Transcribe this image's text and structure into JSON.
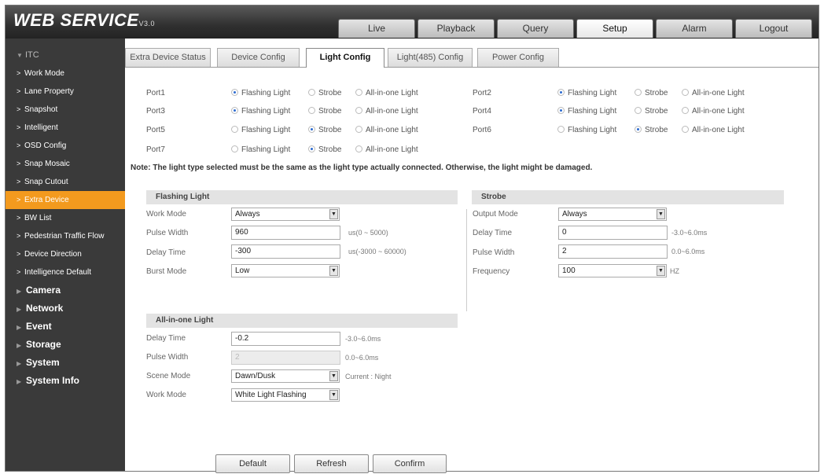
{
  "header": {
    "logo": "WEB SERVICE",
    "version": "V3.0",
    "tabs": [
      "Live",
      "Playback",
      "Query",
      "Setup",
      "Alarm",
      "Logout"
    ],
    "active_tab": "Setup"
  },
  "sidebar": {
    "section": "ITC",
    "items": [
      "Work Mode",
      "Lane Property",
      "Snapshot",
      "Intelligent",
      "OSD Config",
      "Snap Mosaic",
      "Snap Cutout",
      "Extra Device",
      "BW List",
      "Pedestrian Traffic Flow",
      "Device Direction",
      "Intelligence Default"
    ],
    "active_item": "Extra Device",
    "top_items": [
      "Camera",
      "Network",
      "Event",
      "Storage",
      "System",
      "System Info"
    ]
  },
  "subtabs": [
    "Extra Device Status",
    "Device Config",
    "Light Config",
    "Light(485) Config",
    "Power Config"
  ],
  "active_subtab": "Light Config",
  "radio_options": [
    "Flashing Light",
    "Strobe",
    "All-in-one Light"
  ],
  "ports": [
    {
      "label": "Port1",
      "selected": "Flashing Light"
    },
    {
      "label": "Port2",
      "selected": "Flashing Light"
    },
    {
      "label": "Port3",
      "selected": "Flashing Light"
    },
    {
      "label": "Port4",
      "selected": "Flashing Light"
    },
    {
      "label": "Port5",
      "selected": "Strobe"
    },
    {
      "label": "Port6",
      "selected": "Strobe"
    },
    {
      "label": "Port7",
      "selected": "Strobe"
    }
  ],
  "note": "Note: The light type selected must be the same as the light type actually connected. Otherwise, the light might be damaged.",
  "flashing": {
    "title": "Flashing Light",
    "work_mode_label": "Work Mode",
    "work_mode": "Always",
    "pulse_width_label": "Pulse Width",
    "pulse_width": "960",
    "pulse_width_hint": "us(0 ~ 5000)",
    "delay_time_label": "Delay Time",
    "delay_time": "-300",
    "delay_time_hint": "us(-3000 ~ 60000)",
    "burst_mode_label": "Burst Mode",
    "burst_mode": "Low"
  },
  "strobe": {
    "title": "Strobe",
    "output_mode_label": "Output Mode",
    "output_mode": "Always",
    "delay_time_label": "Delay Time",
    "delay_time": "0",
    "delay_time_hint": "-3.0~6.0ms",
    "pulse_width_label": "Pulse Width",
    "pulse_width": "2",
    "pulse_width_hint": "0.0~6.0ms",
    "frequency_label": "Frequency",
    "frequency": "100",
    "frequency_unit": "HZ"
  },
  "allinone": {
    "title": "All-in-one Light",
    "delay_time_label": "Delay Time",
    "delay_time": "-0.2",
    "delay_time_hint": "-3.0~6.0ms",
    "pulse_width_label": "Pulse Width",
    "pulse_width": "2",
    "pulse_width_hint": "0.0~6.0ms",
    "scene_mode_label": "Scene Mode",
    "scene_mode": "Dawn/Dusk",
    "scene_current": "Current : Night",
    "work_mode_label": "Work Mode",
    "work_mode": "White Light Flashing"
  },
  "buttons": {
    "default": "Default",
    "refresh": "Refresh",
    "confirm": "Confirm"
  },
  "colors": {
    "accent": "#f39a1e",
    "sidebar_bg": "#3a3a3a",
    "header_bg": "#2f2f2f"
  }
}
